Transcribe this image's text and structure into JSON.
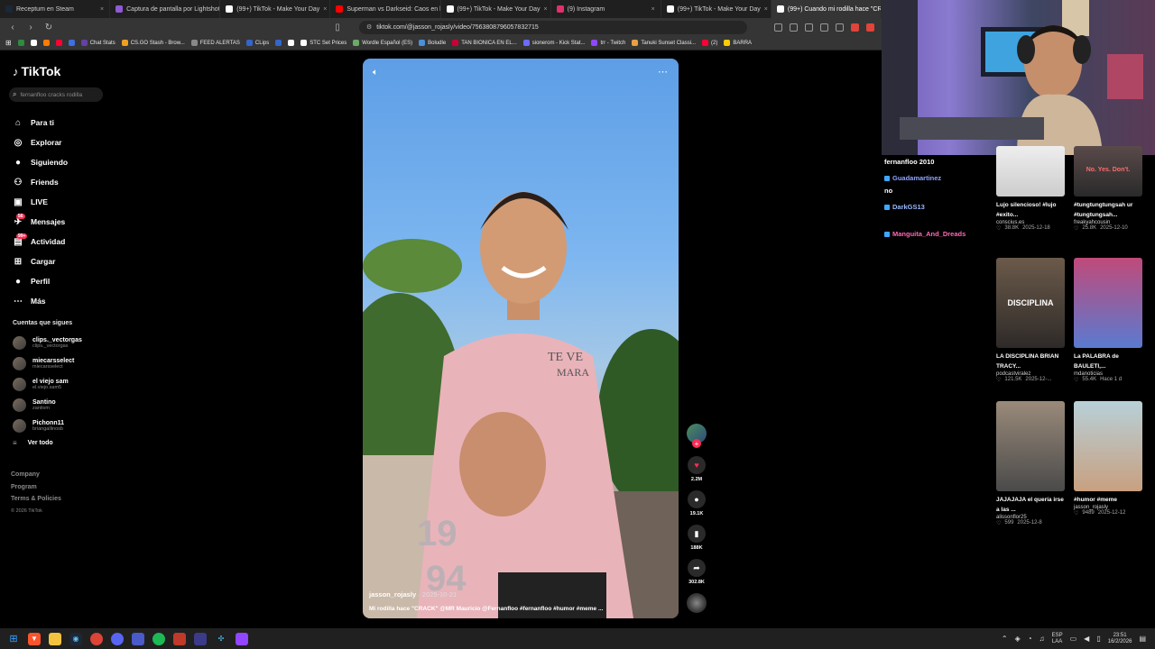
{
  "browser": {
    "tabs": [
      {
        "label": "Receptum en Steam",
        "color": "#1b2838",
        "active": false
      },
      {
        "label": "Captura de pantalla por Lightshot",
        "color": "#8e5bd4",
        "active": false
      },
      {
        "label": "(99+) TikTok - Make Your Day",
        "color": "#ffffff",
        "active": false
      },
      {
        "label": "Superman vs Darkseid: Caos en la ci...",
        "color": "#ff0000",
        "active": false
      },
      {
        "label": "(99+) TikTok - Make Your Day",
        "color": "#ffffff",
        "active": false
      },
      {
        "label": "(9) Instagram",
        "color": "#e1306c",
        "active": false
      },
      {
        "label": "(99+) TikTok - Make Your Day",
        "color": "#ffffff",
        "active": false
      },
      {
        "label": "(99+) Cuando mi rodilla hace \"CR",
        "color": "#ffffff",
        "active": true
      }
    ],
    "url": "tiktok.com/@jasson_rojasly/video/7563808796057832715",
    "bookmarks": [
      {
        "label": "",
        "color": "#2d8c3e"
      },
      {
        "label": "",
        "color": "#ffffff"
      },
      {
        "label": "",
        "color": "#ff7a00"
      },
      {
        "label": "",
        "color": "#ff0033"
      },
      {
        "label": "",
        "color": "#3f6fe0"
      },
      {
        "label": "Chat Stats",
        "color": "#6441a5"
      },
      {
        "label": "CS.GO Stash - Brow...",
        "color": "#f0a020"
      },
      {
        "label": "FEED ALERTAS",
        "color": "#888888"
      },
      {
        "label": "CLips",
        "color": "#3366cc"
      },
      {
        "label": "",
        "color": "#36c"
      },
      {
        "label": "",
        "color": "#fff"
      },
      {
        "label": "STC Set Prices",
        "color": "#ffffff"
      },
      {
        "label": "Wordle Español (ES)",
        "color": "#6aaa64"
      },
      {
        "label": "Boludle",
        "color": "#4a90d9"
      },
      {
        "label": "TAN BIONICA EN EL...",
        "color": "#cc0033"
      },
      {
        "label": "sionerom - Kick Stat...",
        "color": "#6b6bff"
      },
      {
        "label": "trr - Twitch",
        "color": "#9146ff"
      },
      {
        "label": "Tanuki Sunset Classi...",
        "color": "#e8a040"
      },
      {
        "label": "(2)",
        "color": "#ff0033"
      },
      {
        "label": "BARRA",
        "color": "#ffcc00"
      }
    ]
  },
  "tiktok": {
    "logo": "TikTok",
    "search_placeholder": "fernanfloo cracks rodilla",
    "nav": [
      {
        "label": "Para ti",
        "icon": "home-icon",
        "glyph": "⌂"
      },
      {
        "label": "Explorar",
        "icon": "compass-icon",
        "glyph": "◎"
      },
      {
        "label": "Siguiendo",
        "icon": "following-icon",
        "glyph": "●"
      },
      {
        "label": "Friends",
        "icon": "friends-icon",
        "glyph": "⚇"
      },
      {
        "label": "LIVE",
        "icon": "live-icon",
        "glyph": "▣"
      },
      {
        "label": "Mensajes",
        "icon": "messages-icon",
        "glyph": "✈",
        "badge": "56"
      },
      {
        "label": "Actividad",
        "icon": "activity-icon",
        "glyph": "▤",
        "badge": "99+"
      },
      {
        "label": "Cargar",
        "icon": "upload-icon",
        "glyph": "⊞"
      },
      {
        "label": "Perfil",
        "icon": "profile-icon",
        "glyph": "●"
      },
      {
        "label": "Más",
        "icon": "more-icon",
        "glyph": "⋯"
      }
    ],
    "following_header": "Cuentas que sigues",
    "following": [
      {
        "name": "clips._vectorgas",
        "user": "clips._vectorgas"
      },
      {
        "name": "miecarsselect",
        "user": "miecarsselect"
      },
      {
        "name": "el viejo sam",
        "user": "el.viejo.sam5"
      },
      {
        "name": "Santino",
        "user": "zantivm"
      },
      {
        "name": "Pichonn11",
        "user": "briangallinosb"
      }
    ],
    "see_all": "Ver todo",
    "footer": [
      "Company",
      "Program",
      "Terms & Policies"
    ],
    "copyright": "© 2026 TikTok"
  },
  "video": {
    "username": "jasson_rojasly",
    "date": "· 2025-10-21",
    "caption": "Mi rodilla hace \"CRACK\" @MR Mauricio @Fernanfloo #fernanfloo #humor #meme ...",
    "likes": "2.2M",
    "comments": "19.1K",
    "saves": "188K",
    "shares": "302.8K"
  },
  "chat": [
    {
      "user": "fernanfloo 2010",
      "color": "#ffffff"
    },
    {
      "user": "Guadamartinez",
      "color": "#8fa3ff"
    },
    {
      "user": "no",
      "color": "#ffffff"
    },
    {
      "user": "DarkGS13",
      "color": "#9ab7ff"
    },
    {
      "user": "Manguita_And_Dreads",
      "color": "#ff69b4"
    }
  ],
  "recommendations": [
    {
      "title": "Lujo silencioso! #lujo #exito...",
      "author": "conscius.es",
      "likes": "38.8K",
      "date": "2025-12-18",
      "thumb_text": ""
    },
    {
      "title": "#tungtungtungsah ur #tungtungsah...",
      "author": "freakyahcousin",
      "likes": "25.8K",
      "date": "2025-12-10",
      "thumb_text": "No. Yes. Don't."
    },
    {
      "title": "LA DISCIPLINA BRIAN TRACY...",
      "author": "podcastviralez",
      "likes": "121.5K",
      "date": "2025-12-...",
      "thumb_text": "DISCIPLINA"
    },
    {
      "title": "La PALABRA de BAULETI,...",
      "author": "mdanoticias",
      "likes": "55.4K",
      "date": "Hace 1 d",
      "thumb_text": ""
    },
    {
      "title": "JAJAJAJA el quería irse a las ...",
      "author": "alissonflor25",
      "likes": "599",
      "date": "2025-12-8",
      "thumb_text": ""
    },
    {
      "title": "#humor #meme",
      "author": "jasson_rojasly",
      "likes": "9489",
      "date": "2025-12-12",
      "thumb_text": ""
    }
  ],
  "taskbar": {
    "lang_top": "ESP",
    "lang_bottom": "LAA",
    "time": "23:51",
    "date": "16/2/2026"
  }
}
